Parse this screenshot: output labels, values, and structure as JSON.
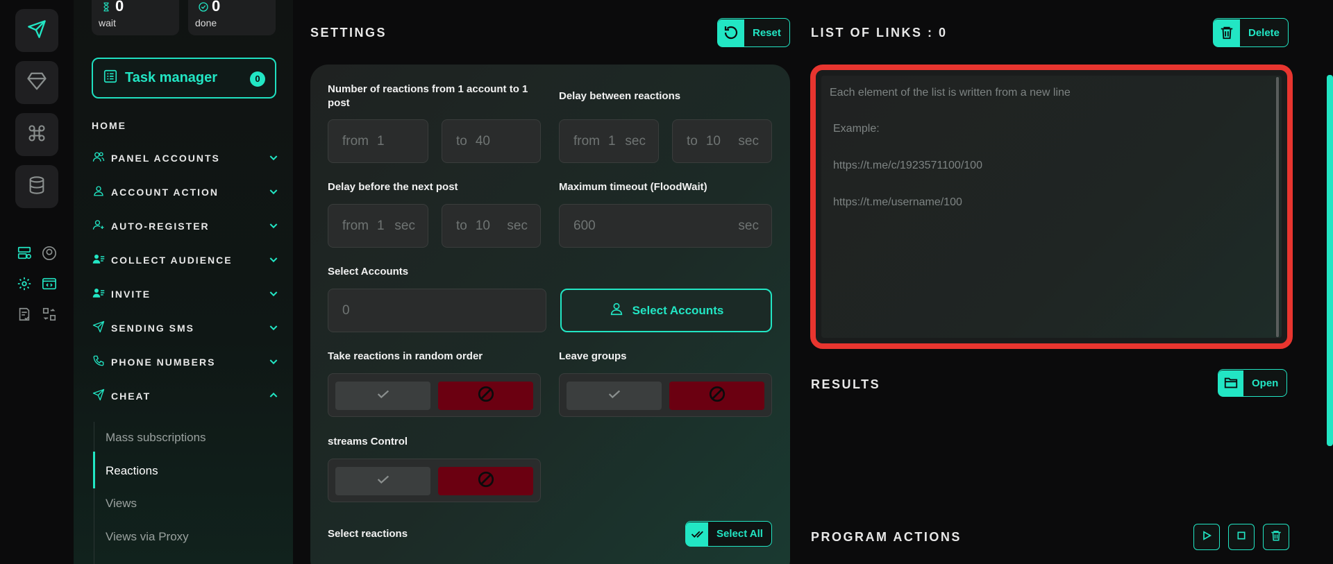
{
  "stats": {
    "wait_value": "0",
    "wait_label": "wait",
    "done_value": "0",
    "done_label": "done"
  },
  "task_manager": {
    "label": "Task manager",
    "count": "0"
  },
  "home_label": "HOME",
  "nav": [
    {
      "label": "PANEL ACCOUNTS",
      "icon": "users-icon"
    },
    {
      "label": "ACCOUNT ACTION",
      "icon": "user-icon"
    },
    {
      "label": "AUTO-REGISTER",
      "icon": "user-plus-icon"
    },
    {
      "label": "COLLECT AUDIENCE",
      "icon": "user-list-icon"
    },
    {
      "label": "INVITE",
      "icon": "user-list-icon"
    },
    {
      "label": "SENDING SMS",
      "icon": "send-icon"
    },
    {
      "label": "PHONE NUMBERS",
      "icon": "phone-icon"
    },
    {
      "label": "CHEAT",
      "icon": "send-icon",
      "expanded": true
    }
  ],
  "cheat_sub": [
    "Mass subscriptions",
    "Reactions",
    "Views",
    "Views via Proxy"
  ],
  "active_sub": "Reactions",
  "settings": {
    "title": "SETTINGS",
    "reset_label": "Reset",
    "reactions_label": "Number of reactions from 1 account to 1 post",
    "reactions_from": {
      "pre": "from",
      "value": "1"
    },
    "reactions_to": {
      "pre": "to",
      "value": "40"
    },
    "delay_reactions_label": "Delay between reactions",
    "delay_reactions_from": {
      "pre": "from",
      "value": "1",
      "suf": "sec"
    },
    "delay_reactions_to": {
      "pre": "to",
      "value": "10",
      "suf": "sec"
    },
    "delay_post_label": "Delay before the next post",
    "delay_post_from": {
      "pre": "from",
      "value": "1",
      "suf": "sec"
    },
    "delay_post_to": {
      "pre": "to",
      "value": "10",
      "suf": "sec"
    },
    "timeout_label": "Maximum timeout (FloodWait)",
    "timeout": {
      "value": "600",
      "suf": "sec"
    },
    "select_accounts_label": "Select Accounts",
    "select_accounts_value": "0",
    "select_accounts_button": "Select Accounts",
    "random_order_label": "Take reactions in random order",
    "leave_groups_label": "Leave groups",
    "streams_label": "streams Control",
    "select_reactions_label": "Select reactions",
    "select_all_label": "Select All"
  },
  "links": {
    "title": "LIST OF LINKS : 0",
    "delete_label": "Delete",
    "placeholder_line1": "Each element of the list is written from a new line",
    "placeholder_example": "Example:",
    "placeholder_link1": "https://t.me/c/1923571100/100",
    "placeholder_link2": "https://t.me/username/100"
  },
  "results": {
    "title": "RESULTS",
    "open_label": "Open"
  },
  "program_actions": {
    "title": "PROGRAM ACTIONS"
  },
  "colors": {
    "accent": "#22e6c4",
    "danger": "#6b0011",
    "highlight": "#e8352f"
  }
}
